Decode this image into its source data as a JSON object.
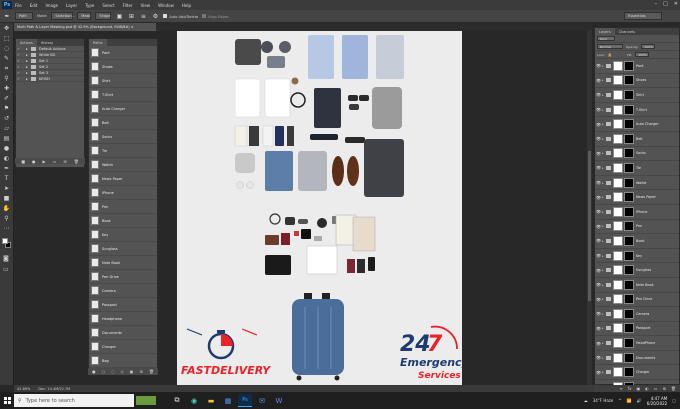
{
  "app": {
    "logo": "Ps",
    "menu": [
      "File",
      "Edit",
      "Image",
      "Layer",
      "Type",
      "Select",
      "Filter",
      "View",
      "Window",
      "Help"
    ],
    "window_controls": [
      "–",
      "□",
      "✕"
    ]
  },
  "options_bar": {
    "tool_mode": "Path",
    "make_label": "Make:",
    "selection_btn": "Selection...",
    "mask_btn": "Mask",
    "shape_btn": "Shape",
    "auto_add_delete": "Auto Add/Delete",
    "align_edges": "Align Edges",
    "workspace": "Essentials"
  },
  "document": {
    "tab_title": "Multi Path & Layer Masking.psd @ 42.9% (Background, RGB/8#) ×",
    "zoom": "42.89%",
    "doc_info": "Doc: 14.4M/22.7M"
  },
  "actions_panel": {
    "tabs": [
      "Actions",
      "History"
    ],
    "rows": [
      "Default Actions",
      "White BG",
      "Set 1",
      "Set 2",
      "Set 3",
      "KRISH"
    ]
  },
  "paths_panel": {
    "tab": "Paths",
    "rows": [
      "Pant",
      "Shoes",
      "Shirt",
      "T-Shirt",
      "Auto Charger",
      "Belt",
      "Socks",
      "Tie",
      "Wallet",
      "News Paper",
      "iPhone",
      "Pen",
      "Book",
      "Key",
      "Sunglass",
      "Note Book",
      "Pen Drive",
      "Camera",
      "Passport",
      "Headphone",
      "Documents",
      "Charger",
      "Bag"
    ]
  },
  "layers_panel": {
    "tabs": [
      "Layers",
      "Channels"
    ],
    "kind": "Kind",
    "blend": "Normal",
    "opacity_label": "Opacity:",
    "opacity": "100%",
    "lock_label": "Lock:",
    "fill_label": "Fill:",
    "fill": "100%",
    "rows": [
      "Pant",
      "Shoes",
      "Shirt",
      "T-Shirt",
      "Auto Charger",
      "Belt",
      "Socks",
      "Tie",
      "Wallet",
      "News Paper",
      "iPhone",
      "Pen",
      "Book",
      "Key",
      "Sunglass",
      "Note Book",
      "Pen Drive",
      "Camera",
      "Passport",
      "HeadPhone",
      "Documents",
      "Charger",
      "Bag"
    ]
  },
  "canvas_logos": {
    "fast_delivery": "FASTDELIVERY",
    "emergency_24": "24",
    "emergency_7": "7",
    "emergency_line1": "Emergency",
    "emergency_line2": "Services"
  },
  "taskbar": {
    "search_placeholder": "Type here to search",
    "weather": "34°F  Haze",
    "time": "4:47 AM",
    "date": "6/20/2022"
  },
  "colors": {
    "ps_blue": "#31a8ff",
    "delivery_red": "#e8232a",
    "delivery_navy": "#1c3b6e",
    "suitcase_blue": "#4a6d9a"
  }
}
